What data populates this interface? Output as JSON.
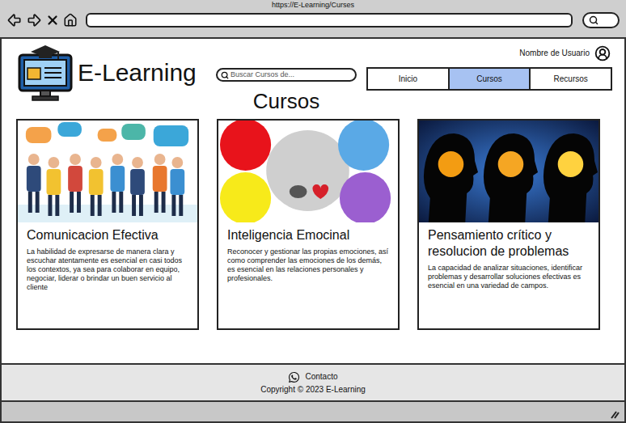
{
  "browser": {
    "url": "https://E-Learning/Curses"
  },
  "header": {
    "brand": "E-Learning",
    "search_placeholder": "Buscar Cursos de...",
    "user": "Nombre de Usuario"
  },
  "nav": [
    {
      "label": "Inicio",
      "selected": false
    },
    {
      "label": "Cursos",
      "selected": true
    },
    {
      "label": "Recursos",
      "selected": false
    }
  ],
  "page_title": "Cursos",
  "courses": [
    {
      "kind": "people",
      "title": "Comunicacion Efectiva",
      "description": "La habilidad de expresarse de manera clara y escuchar atentamente es esencial en casi todos los contextos, ya sea para colaborar en equipo, negociar, liderar o brindar un buen servicio al cliente"
    },
    {
      "kind": "circles",
      "title": "Inteligencia Emocinal",
      "description": "Reconocer y gestionar las propias emociones, así como comprender las emociones de los demás, es esencial en las relaciones personales y profesionales."
    },
    {
      "kind": "heads",
      "title": "Pensamiento crítico y resolucion de problemas",
      "description": "La capacidad de analizar situaciones, identificar problemas y desarrollar soluciones efectivas es esencial en una variedad de campos."
    }
  ],
  "footer": {
    "contact": "Contacto",
    "copyright": "Copyright © 2023 E-Learning"
  }
}
